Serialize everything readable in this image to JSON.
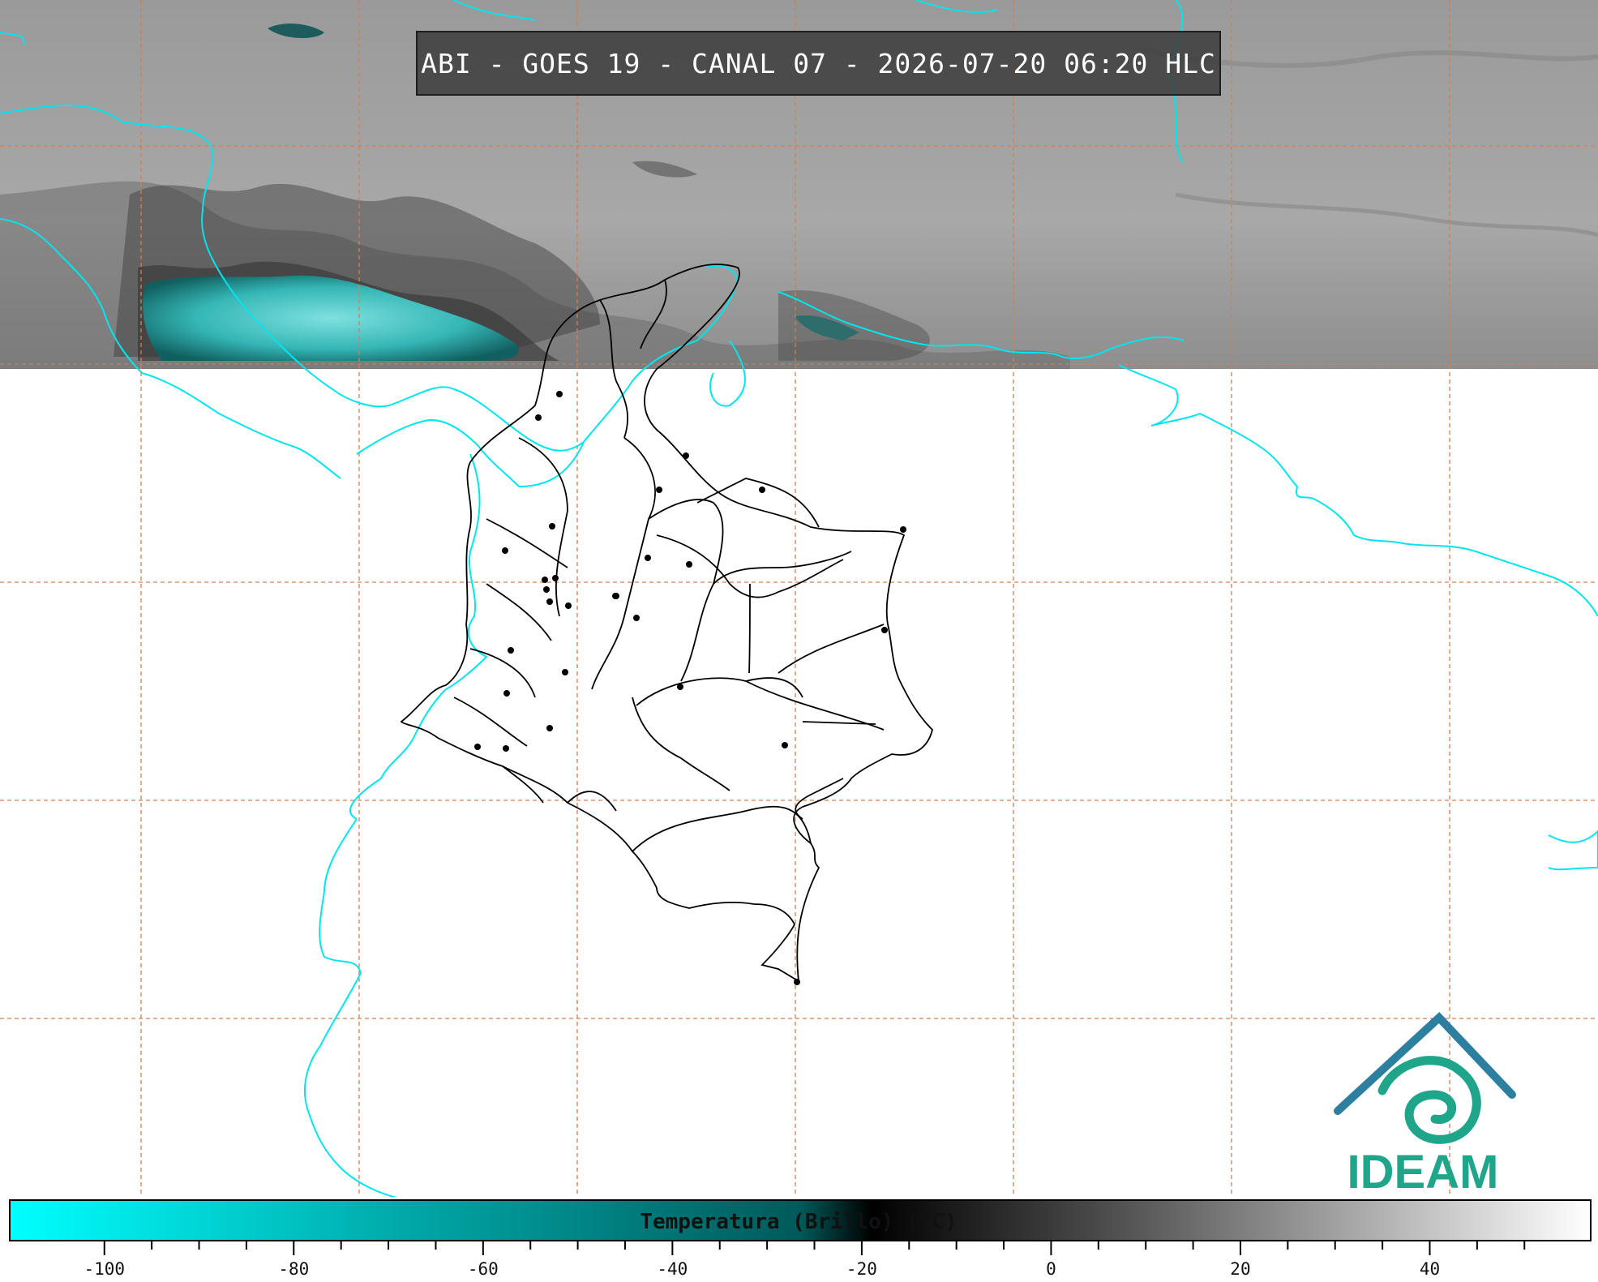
{
  "title": "ABI - GOES 19 - CANAL 07 - 2026-07-20 06:20 HLC",
  "logo": {
    "text": "IDEAM",
    "color": "#1fa58a"
  },
  "colorbar": {
    "label": "Temperatura (Brillo) (°C)",
    "ticks": [
      "-100",
      "-80",
      "-60",
      "-40",
      "-20",
      "0",
      "20",
      "40"
    ],
    "min_value": -110,
    "max_value": 57,
    "colors": {
      "cold": "#00ffff",
      "mid_teal": "#005a5a",
      "neutral": "#000000",
      "warm": "#ffffff"
    }
  },
  "map": {
    "satellite_coverage": "north-band",
    "grid_color": "#d2804f",
    "coastline_color": "#00e5ee",
    "borders_color": "#000000",
    "convective_cloud_color": "#2fb8b8",
    "background_cloud_color": "#a4a4a4"
  }
}
